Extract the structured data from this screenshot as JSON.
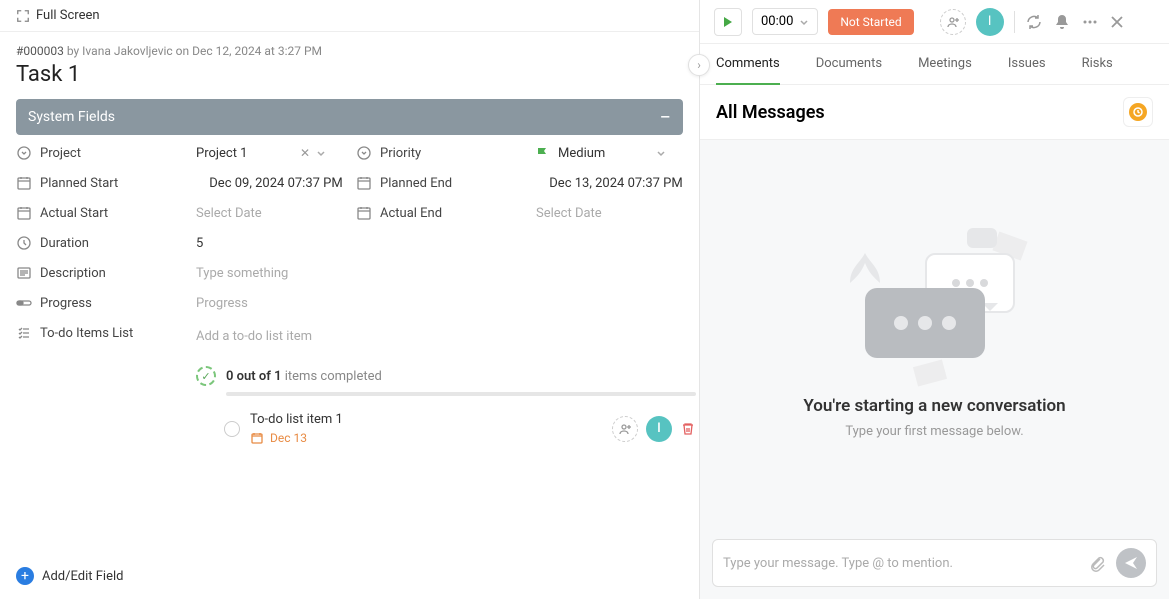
{
  "header": {
    "fullscreen": "Full Screen"
  },
  "meta": {
    "id": "#000003",
    "byline": "by Ivana Jakovljevic on Dec 12, 2024 at 3:27 PM"
  },
  "task": {
    "title": "Task 1"
  },
  "section": {
    "title": "System Fields"
  },
  "fields": {
    "project_label": "Project",
    "project_value": "Project 1",
    "priority_label": "Priority",
    "priority_value": "Medium",
    "planned_start_label": "Planned Start",
    "planned_start_value": "Dec 09, 2024 07:37 PM",
    "planned_end_label": "Planned End",
    "planned_end_value": "Dec 13, 2024 07:37 PM",
    "actual_start_label": "Actual Start",
    "actual_start_value": "Select Date",
    "actual_end_label": "Actual End",
    "actual_end_value": "Select Date",
    "duration_label": "Duration",
    "duration_value": "5",
    "description_label": "Description",
    "description_placeholder": "Type something",
    "progress_label": "Progress",
    "progress_placeholder": "Progress",
    "todo_label": "To-do Items List",
    "todo_add_placeholder": "Add a to-do list item"
  },
  "todo_progress": {
    "count": "0 out of 1",
    "suffix": "items completed"
  },
  "todo_item": {
    "title": "To-do list item 1",
    "date": "Dec 13",
    "avatar": "I"
  },
  "add_field": "Add/Edit Field",
  "toolbar": {
    "timer": "00:00",
    "status": "Not Started",
    "avatar": "I"
  },
  "tabs": {
    "comments": "Comments",
    "documents": "Documents",
    "meetings": "Meetings",
    "issues": "Issues",
    "risks": "Risks"
  },
  "messages": {
    "header": "All Messages",
    "empty_title": "You're starting a new conversation",
    "empty_sub": "Type your first message below.",
    "composer_placeholder": "Type your message. Type @ to mention."
  },
  "colors": {
    "accent": "#4caf50",
    "status": "#ef7a55",
    "avatar": "#57c3c1",
    "priority_flag": "#4caf50",
    "clock": "#f5a623"
  }
}
